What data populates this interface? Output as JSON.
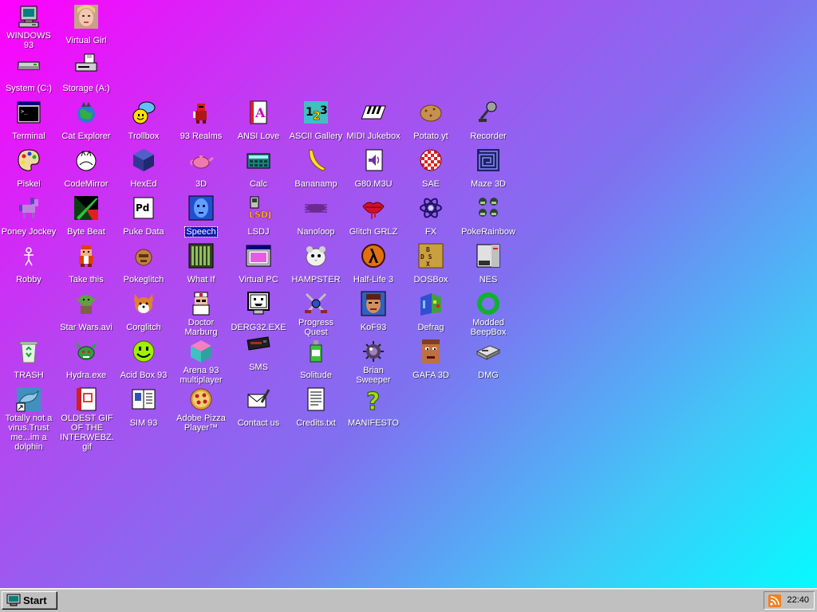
{
  "desktop": {
    "icons": [
      {
        "label": "WINDOWS 93",
        "icon": "computer-icon"
      },
      {
        "label": "Virtual Girl",
        "icon": "face-portrait-icon"
      },
      {
        "label": "System (C:)",
        "icon": "hard-drive-icon"
      },
      {
        "label": "Storage (A:)",
        "icon": "floppy-drive-icon"
      },
      {
        "label": "Terminal",
        "icon": "terminal-icon"
      },
      {
        "label": "Cat Explorer",
        "icon": "cat-globe-icon"
      },
      {
        "label": "Trollbox",
        "icon": "chat-smiley-icon"
      },
      {
        "label": "93 Realms",
        "icon": "knight-icon"
      },
      {
        "label": "ANSI Love",
        "icon": "ansi-letter-icon"
      },
      {
        "label": "ASCII Gallery",
        "icon": "ascii-numbers-icon"
      },
      {
        "label": "MIDI Jukebox",
        "icon": "piano-keys-icon"
      },
      {
        "label": "Potato.yt",
        "icon": "potato-icon"
      },
      {
        "label": "Recorder",
        "icon": "microphone-icon"
      },
      {
        "label": "Piskel",
        "icon": "paint-palette-icon"
      },
      {
        "label": "CodeMirror",
        "icon": "cat-mirror-icon"
      },
      {
        "label": "HexEd",
        "icon": "hex-cube-icon"
      },
      {
        "label": "3D",
        "icon": "teapot-icon"
      },
      {
        "label": "Calc",
        "icon": "calculator-icon"
      },
      {
        "label": "Bananamp",
        "icon": "banana-icon"
      },
      {
        "label": "G80.M3U",
        "icon": "audio-file-icon"
      },
      {
        "label": "SAE",
        "icon": "checkered-ball-icon"
      },
      {
        "label": "Maze 3D",
        "icon": "maze-icon"
      },
      {
        "label": "Poney Jockey",
        "icon": "pony-icon"
      },
      {
        "label": "Byte Beat",
        "icon": "byte-beat-icon"
      },
      {
        "label": "Puke Data",
        "icon": "puke-data-icon"
      },
      {
        "label": "Speech",
        "icon": "blue-face-icon"
      },
      {
        "label": "LSDJ",
        "icon": "lsdj-icon"
      },
      {
        "label": "Nanoloop",
        "icon": "wave-lines-icon"
      },
      {
        "label": "Glitch GRLZ",
        "icon": "lips-icon"
      },
      {
        "label": "FX",
        "icon": "atom-icon"
      },
      {
        "label": "PokeRainbow",
        "icon": "pokemon-trainers-icon"
      },
      {
        "label": "Robby",
        "icon": "stick-figure-icon"
      },
      {
        "label": "Take this",
        "icon": "pixel-character-icon"
      },
      {
        "label": "Pokeglitch",
        "icon": "pokeglitch-icon"
      },
      {
        "label": "What If",
        "icon": "green-bars-icon"
      },
      {
        "label": "Virtual PC",
        "icon": "virtual-pc-window-icon"
      },
      {
        "label": "HAMPSTER",
        "icon": "hamster-icon"
      },
      {
        "label": "Half-Life 3",
        "icon": "lambda-icon"
      },
      {
        "label": "DOSBox",
        "icon": "dosbox-icon"
      },
      {
        "label": "NES",
        "icon": "nes-console-icon"
      },
      {
        "label": "Star Wars.avi",
        "icon": "yoda-icon"
      },
      {
        "label": "Corglitch",
        "icon": "corgi-icon"
      },
      {
        "label": "Doctor Marburg",
        "icon": "doctor-icon"
      },
      {
        "label": "DERG32.EXE",
        "icon": "monitor-face-icon"
      },
      {
        "label": "Progress Quest",
        "icon": "crossed-swords-icon"
      },
      {
        "label": "KoF93",
        "icon": "fighter-portrait-icon"
      },
      {
        "label": "Defrag",
        "icon": "defrag-icon"
      },
      {
        "label": "Modded BeepBox",
        "icon": "green-ring-icon"
      },
      {
        "label": "TRASH",
        "icon": "recycle-bin-icon"
      },
      {
        "label": "Hydra.exe",
        "icon": "hydra-icon"
      },
      {
        "label": "Acid Box 93",
        "icon": "acid-smiley-icon"
      },
      {
        "label": "Arena 93 multiplayer",
        "icon": "arena-cube-icon"
      },
      {
        "label": "SMS",
        "icon": "sms-console-icon"
      },
      {
        "label": "Solitude",
        "icon": "bottle-icon"
      },
      {
        "label": "Brian Sweeper",
        "icon": "mine-icon"
      },
      {
        "label": "GAFA 3D",
        "icon": "doom-face-icon"
      },
      {
        "label": "DMG",
        "icon": "dmg-disk-icon"
      },
      {
        "label": "Totally not a virus.Trust me...im a dolphin",
        "icon": "dolphin-shortcut-icon"
      },
      {
        "label": "OLDEST GIF OF THE INTERWEBZ.gif",
        "icon": "gif-file-icon"
      },
      {
        "label": "SIM 93",
        "icon": "sim-book-icon"
      },
      {
        "label": "Adobe Pizza Player™",
        "icon": "pizza-icon"
      },
      {
        "label": "Contact us",
        "icon": "letter-pen-icon"
      },
      {
        "label": "Credits.txt",
        "icon": "text-file-icon"
      },
      {
        "label": "MANIFESTO",
        "icon": "question-mark-icon"
      }
    ]
  },
  "taskbar": {
    "start_label": "Start",
    "clock": "22:40",
    "tray_icon": "rss-icon"
  },
  "colors": {
    "gradient_top_left": "#ff00ff",
    "gradient_bottom_right": "#00ffff",
    "taskbar": "#c0c0c0",
    "selection": "#0a1aa8"
  }
}
